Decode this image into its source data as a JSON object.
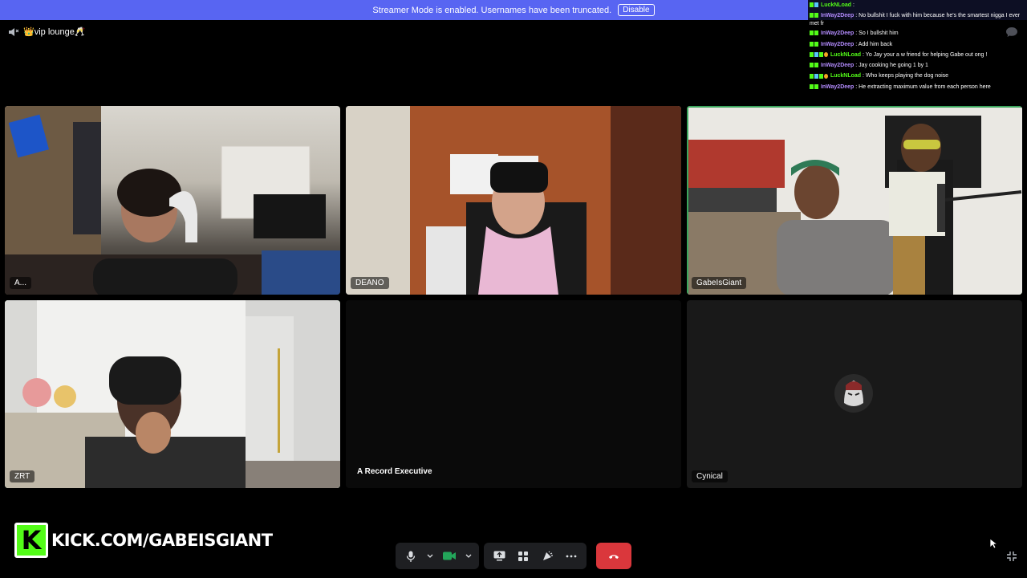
{
  "banner": {
    "text": "Streamer Mode is enabled. Usernames have been truncated.",
    "button": "Disable"
  },
  "channel": {
    "name": "👑vip lounge🥂"
  },
  "chat": {
    "lines": [
      {
        "user": "LuckNLoad",
        "message": ":",
        "color": "#53fc18"
      },
      {
        "user": "InWay2Deep",
        "message": ": No bullshit I fuck with him because he's the smartest nigga I ever met fr",
        "color": "#b48cff",
        "wrap": true
      },
      {
        "user": "InWay2Deep",
        "message": ": So I bullshit him",
        "color": "#b48cff"
      },
      {
        "user": "InWay2Deep",
        "message": ": Add him back",
        "color": "#b48cff"
      },
      {
        "user": "LuckNLoad",
        "message": ": Yo Jay your a w friend for helping Gabe out ong !",
        "color": "#53fc18"
      },
      {
        "user": "InWay2Deep",
        "message": ": Jay cooking he going 1 by 1",
        "color": "#b48cff"
      },
      {
        "user": "LuckNLoad",
        "message": ": Who keeps playing the dog noise",
        "color": "#53fc18"
      },
      {
        "user": "InWay2Deep",
        "message": ": He extracting maximum value from each person here",
        "color": "#b48cff"
      }
    ]
  },
  "tiles": [
    {
      "name": "A...",
      "speaking": false
    },
    {
      "name": "DEANO",
      "speaking": false
    },
    {
      "name": "GabeIsGiant",
      "speaking": true
    },
    {
      "name": "ZRT",
      "speaking": true
    },
    {
      "name": "A Record Executive",
      "speaking": false
    },
    {
      "name": "Cynical",
      "speaking": false
    }
  ],
  "overlay": {
    "brand": "KICK.COM/GABEISGIANT",
    "logo_letter": "K",
    "accent": "#53fc18"
  },
  "controls": {
    "end_color": "#da373c",
    "video_color": "#23a55a"
  }
}
